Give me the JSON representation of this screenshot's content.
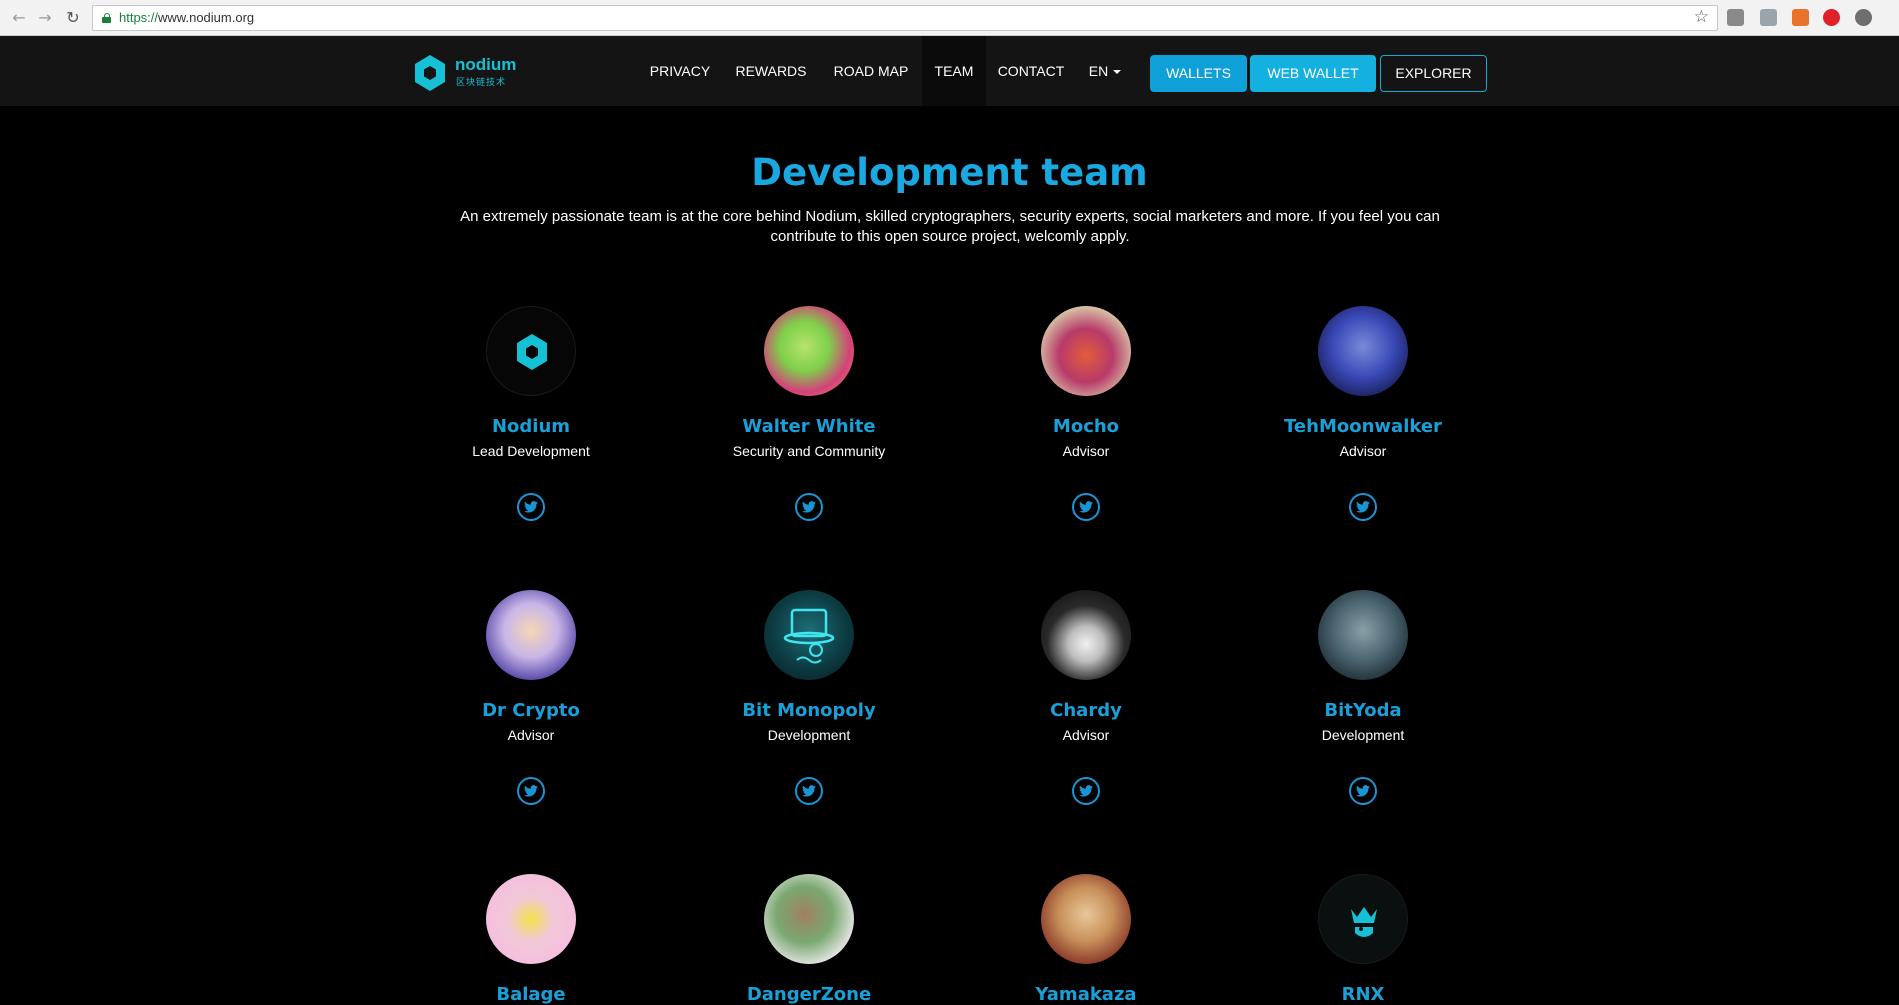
{
  "browser": {
    "url_proto": "https://",
    "url_host": "www.nodium.org"
  },
  "header": {
    "logo_name": "nodium",
    "logo_sub": "区块链技术",
    "menu": [
      "PRIVACY",
      "REWARDS",
      "ROAD MAP",
      "TEAM",
      "CONTACT",
      "EN"
    ],
    "active_menu": "TEAM",
    "buttons": [
      "WALLETS",
      "WEB WALLET",
      "EXPLORER"
    ]
  },
  "main": {
    "title": "Development team",
    "intro": "An extremely passionate team is at the core behind Nodium, skilled cryptographers, security experts, social marketers and more. If you feel you can contribute to this open source project, welcomly apply."
  },
  "team": [
    {
      "name": "Nodium",
      "role": "Lead Development"
    },
    {
      "name": "Walter White",
      "role": "Security and Community"
    },
    {
      "name": "Mocho",
      "role": "Advisor"
    },
    {
      "name": "TehMoonwalker",
      "role": "Advisor"
    },
    {
      "name": "Dr Crypto",
      "role": "Advisor"
    },
    {
      "name": "Bit Monopoly",
      "role": "Development"
    },
    {
      "name": "Chardy",
      "role": "Advisor"
    },
    {
      "name": "BitYoda",
      "role": "Development"
    },
    {
      "name": "Balage",
      "role": ""
    },
    {
      "name": "DangerZone",
      "role": ""
    },
    {
      "name": "Yamakaza",
      "role": ""
    },
    {
      "name": "RNX",
      "role": ""
    }
  ],
  "colors": {
    "accent": "#1aa0d8",
    "logo": "#16c1d6",
    "header_bg": "#141414",
    "page_bg": "#000000"
  }
}
